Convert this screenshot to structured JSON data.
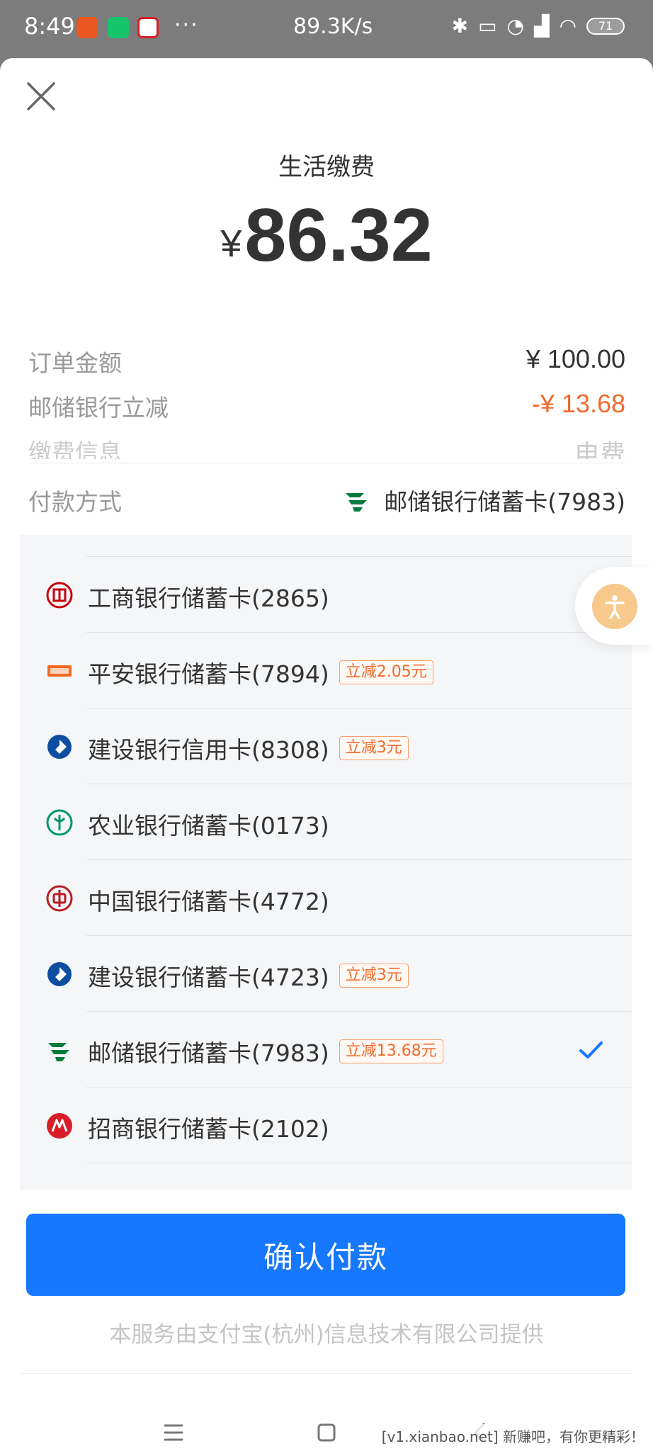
{
  "status_bar": {
    "time": "8:49",
    "dots": "···",
    "net_speed": "89.3K/s",
    "battery": "71",
    "icons": [
      "bluetooth-icon",
      "vibrate-icon",
      "alarm-icon",
      "hd-signal-icon",
      "wifi-icon"
    ]
  },
  "header": {
    "title": "生活缴费",
    "currency": "¥",
    "amount": "86.32"
  },
  "details": {
    "order_label": "订单金额",
    "order_value": "¥ 100.00",
    "discount_label": "邮储银行立减",
    "discount_value": "-¥ 13.68",
    "info_label": "缴费信息",
    "info_value": "电费"
  },
  "payment": {
    "label": "付款方式",
    "selected": "邮储银行储蓄卡(7983)"
  },
  "cards": [
    {
      "name": "工商银行储蓄卡(2865)",
      "badge": "",
      "icon": "icbc-icon",
      "color": "#c7000b",
      "selected": false
    },
    {
      "name": "平安银行储蓄卡(7894)",
      "badge": "立减2.05元",
      "icon": "pingan-bank-icon",
      "color": "#f26b21",
      "selected": false
    },
    {
      "name": "建设银行信用卡(8308)",
      "badge": "立减3元",
      "icon": "ccb-icon",
      "color": "#0e4ea1",
      "selected": false
    },
    {
      "name": "农业银行储蓄卡(0173)",
      "badge": "",
      "icon": "abc-bank-icon",
      "color": "#00966b",
      "selected": false
    },
    {
      "name": "中国银行储蓄卡(4772)",
      "badge": "",
      "icon": "boc-icon",
      "color": "#b81c22",
      "selected": false
    },
    {
      "name": "建设银行储蓄卡(4723)",
      "badge": "立减3元",
      "icon": "ccb-icon",
      "color": "#0e4ea1",
      "selected": false
    },
    {
      "name": "邮储银行储蓄卡(7983)",
      "badge": "立减13.68元",
      "icon": "psbc-icon",
      "color": "#007a3d",
      "selected": true
    },
    {
      "name": "招商银行储蓄卡(2102)",
      "badge": "",
      "icon": "cmb-icon",
      "color": "#d71e28",
      "selected": false
    }
  ],
  "confirm_label": "确认付款",
  "provider_text": "本服务由支付宝(杭州)信息技术有限公司提供",
  "watermark": "[v1.xianbao.net] 新赚吧，有你更精彩！",
  "colors": {
    "primary": "#1677ff",
    "discount": "#f06a2d",
    "check": "#1677ff"
  }
}
